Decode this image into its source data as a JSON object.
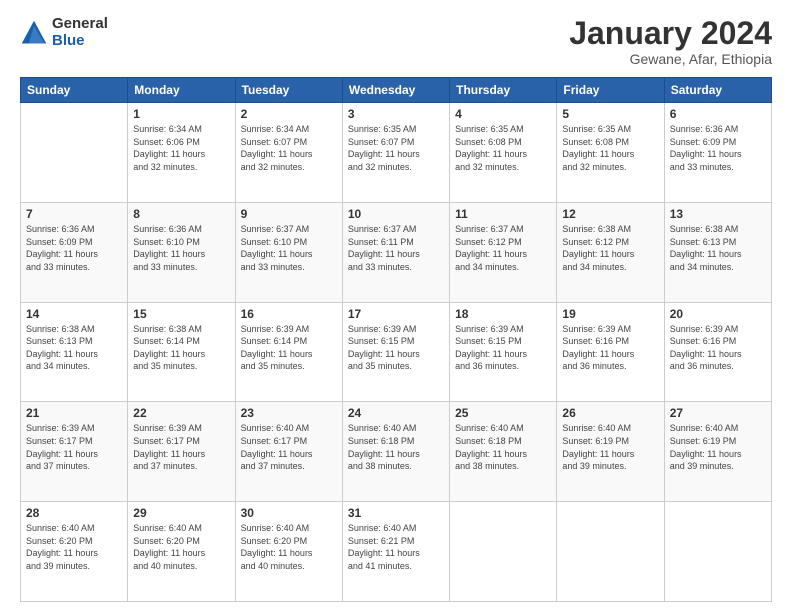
{
  "logo": {
    "general": "General",
    "blue": "Blue"
  },
  "title": "January 2024",
  "subtitle": "Gewane, Afar, Ethiopia",
  "days_header": [
    "Sunday",
    "Monday",
    "Tuesday",
    "Wednesday",
    "Thursday",
    "Friday",
    "Saturday"
  ],
  "weeks": [
    [
      {
        "num": "",
        "info": ""
      },
      {
        "num": "1",
        "info": "Sunrise: 6:34 AM\nSunset: 6:06 PM\nDaylight: 11 hours\nand 32 minutes."
      },
      {
        "num": "2",
        "info": "Sunrise: 6:34 AM\nSunset: 6:07 PM\nDaylight: 11 hours\nand 32 minutes."
      },
      {
        "num": "3",
        "info": "Sunrise: 6:35 AM\nSunset: 6:07 PM\nDaylight: 11 hours\nand 32 minutes."
      },
      {
        "num": "4",
        "info": "Sunrise: 6:35 AM\nSunset: 6:08 PM\nDaylight: 11 hours\nand 32 minutes."
      },
      {
        "num": "5",
        "info": "Sunrise: 6:35 AM\nSunset: 6:08 PM\nDaylight: 11 hours\nand 32 minutes."
      },
      {
        "num": "6",
        "info": "Sunrise: 6:36 AM\nSunset: 6:09 PM\nDaylight: 11 hours\nand 33 minutes."
      }
    ],
    [
      {
        "num": "7",
        "info": "Sunrise: 6:36 AM\nSunset: 6:09 PM\nDaylight: 11 hours\nand 33 minutes."
      },
      {
        "num": "8",
        "info": "Sunrise: 6:36 AM\nSunset: 6:10 PM\nDaylight: 11 hours\nand 33 minutes."
      },
      {
        "num": "9",
        "info": "Sunrise: 6:37 AM\nSunset: 6:10 PM\nDaylight: 11 hours\nand 33 minutes."
      },
      {
        "num": "10",
        "info": "Sunrise: 6:37 AM\nSunset: 6:11 PM\nDaylight: 11 hours\nand 33 minutes."
      },
      {
        "num": "11",
        "info": "Sunrise: 6:37 AM\nSunset: 6:12 PM\nDaylight: 11 hours\nand 34 minutes."
      },
      {
        "num": "12",
        "info": "Sunrise: 6:38 AM\nSunset: 6:12 PM\nDaylight: 11 hours\nand 34 minutes."
      },
      {
        "num": "13",
        "info": "Sunrise: 6:38 AM\nSunset: 6:13 PM\nDaylight: 11 hours\nand 34 minutes."
      }
    ],
    [
      {
        "num": "14",
        "info": "Sunrise: 6:38 AM\nSunset: 6:13 PM\nDaylight: 11 hours\nand 34 minutes."
      },
      {
        "num": "15",
        "info": "Sunrise: 6:38 AM\nSunset: 6:14 PM\nDaylight: 11 hours\nand 35 minutes."
      },
      {
        "num": "16",
        "info": "Sunrise: 6:39 AM\nSunset: 6:14 PM\nDaylight: 11 hours\nand 35 minutes."
      },
      {
        "num": "17",
        "info": "Sunrise: 6:39 AM\nSunset: 6:15 PM\nDaylight: 11 hours\nand 35 minutes."
      },
      {
        "num": "18",
        "info": "Sunrise: 6:39 AM\nSunset: 6:15 PM\nDaylight: 11 hours\nand 36 minutes."
      },
      {
        "num": "19",
        "info": "Sunrise: 6:39 AM\nSunset: 6:16 PM\nDaylight: 11 hours\nand 36 minutes."
      },
      {
        "num": "20",
        "info": "Sunrise: 6:39 AM\nSunset: 6:16 PM\nDaylight: 11 hours\nand 36 minutes."
      }
    ],
    [
      {
        "num": "21",
        "info": "Sunrise: 6:39 AM\nSunset: 6:17 PM\nDaylight: 11 hours\nand 37 minutes."
      },
      {
        "num": "22",
        "info": "Sunrise: 6:39 AM\nSunset: 6:17 PM\nDaylight: 11 hours\nand 37 minutes."
      },
      {
        "num": "23",
        "info": "Sunrise: 6:40 AM\nSunset: 6:17 PM\nDaylight: 11 hours\nand 37 minutes."
      },
      {
        "num": "24",
        "info": "Sunrise: 6:40 AM\nSunset: 6:18 PM\nDaylight: 11 hours\nand 38 minutes."
      },
      {
        "num": "25",
        "info": "Sunrise: 6:40 AM\nSunset: 6:18 PM\nDaylight: 11 hours\nand 38 minutes."
      },
      {
        "num": "26",
        "info": "Sunrise: 6:40 AM\nSunset: 6:19 PM\nDaylight: 11 hours\nand 39 minutes."
      },
      {
        "num": "27",
        "info": "Sunrise: 6:40 AM\nSunset: 6:19 PM\nDaylight: 11 hours\nand 39 minutes."
      }
    ],
    [
      {
        "num": "28",
        "info": "Sunrise: 6:40 AM\nSunset: 6:20 PM\nDaylight: 11 hours\nand 39 minutes."
      },
      {
        "num": "29",
        "info": "Sunrise: 6:40 AM\nSunset: 6:20 PM\nDaylight: 11 hours\nand 40 minutes."
      },
      {
        "num": "30",
        "info": "Sunrise: 6:40 AM\nSunset: 6:20 PM\nDaylight: 11 hours\nand 40 minutes."
      },
      {
        "num": "31",
        "info": "Sunrise: 6:40 AM\nSunset: 6:21 PM\nDaylight: 11 hours\nand 41 minutes."
      },
      {
        "num": "",
        "info": ""
      },
      {
        "num": "",
        "info": ""
      },
      {
        "num": "",
        "info": ""
      }
    ]
  ]
}
